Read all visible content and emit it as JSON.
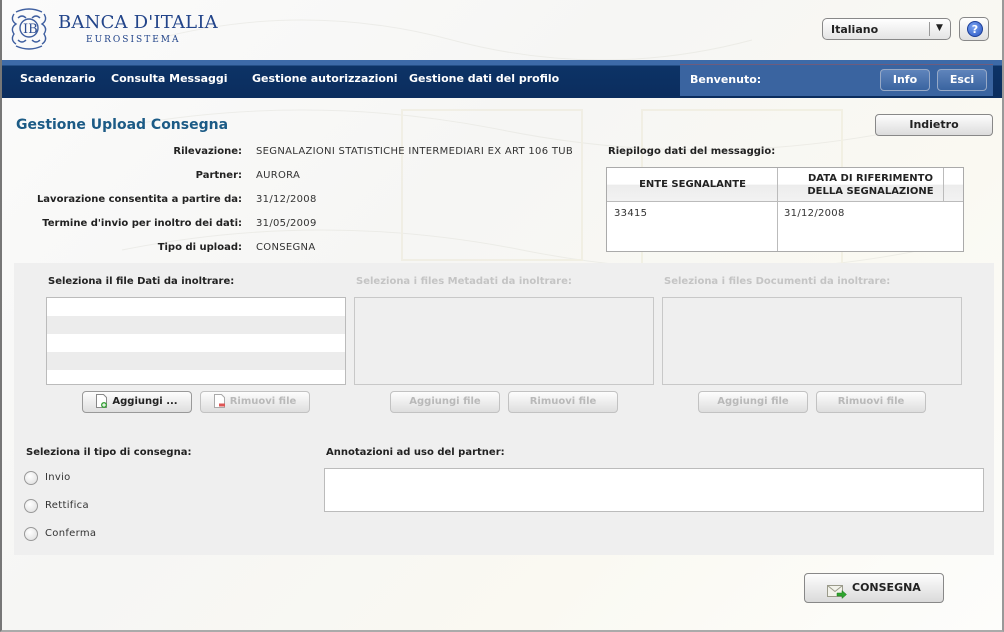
{
  "header": {
    "brand_name": "BANCA D'ITALIA",
    "brand_sub": "EUROSISTEMA",
    "language": {
      "selected": "Italiano",
      "arrow_icon": "chevron-down-icon"
    },
    "help_icon": "help-icon",
    "help_glyph": "?"
  },
  "nav": {
    "items": [
      {
        "label": "Scadenzario"
      },
      {
        "label": "Consulta Messaggi"
      },
      {
        "label": "Gestione autorizzazioni"
      },
      {
        "label": "Gestione dati del profilo"
      }
    ],
    "welcome": "Benvenuto:",
    "info_label": "Info",
    "exit_label": "Esci"
  },
  "page": {
    "title": "Gestione Upload Consegna",
    "back_label": "Indietro",
    "details": [
      {
        "label": "Rilevazione:",
        "value": "SEGNALAZIONI STATISTICHE INTERMEDIARI EX ART 106 TUB"
      },
      {
        "label": "Partner:",
        "value": "AURORA"
      },
      {
        "label": "Lavorazione consentita a partire da:",
        "value": "31/12/2008"
      },
      {
        "label": "Termine d'invio per inoltro dei dati:",
        "value": "31/05/2009"
      },
      {
        "label": "Tipo di upload:",
        "value": "CONSEGNA"
      }
    ],
    "summary": {
      "title": "Riepilogo dati del messaggio:",
      "columns": [
        "ENTE SEGNALANTE",
        "DATA DI RIFERIMENTO DELLA SEGNALAZIONE"
      ],
      "rows": [
        [
          "33415",
          "31/12/2008"
        ]
      ]
    }
  },
  "upload": {
    "groups": [
      {
        "label": "Seleziona il file Dati da inoltrare:",
        "add_label": "Aggiungi ...",
        "remove_label": "Rimuovi file",
        "enabled": true
      },
      {
        "label": "Seleziona i files Metadati da inoltrare:",
        "add_label": "Aggiungi file",
        "remove_label": "Rimuovi file",
        "enabled": false
      },
      {
        "label": "Seleziona i files Documenti da inoltrare:",
        "add_label": "Aggiungi file",
        "remove_label": "Rimuovi file",
        "enabled": false
      }
    ],
    "delivery_type": {
      "title": "Seleziona il tipo di consegna:",
      "options": [
        {
          "label": "Invio",
          "checked": false
        },
        {
          "label": "Rettifica",
          "checked": false
        },
        {
          "label": "Conferma",
          "checked": false
        }
      ]
    },
    "notes": {
      "label": "Annotazioni ad uso del partner:",
      "value": ""
    }
  },
  "submit": {
    "label": "CONSEGNA"
  }
}
